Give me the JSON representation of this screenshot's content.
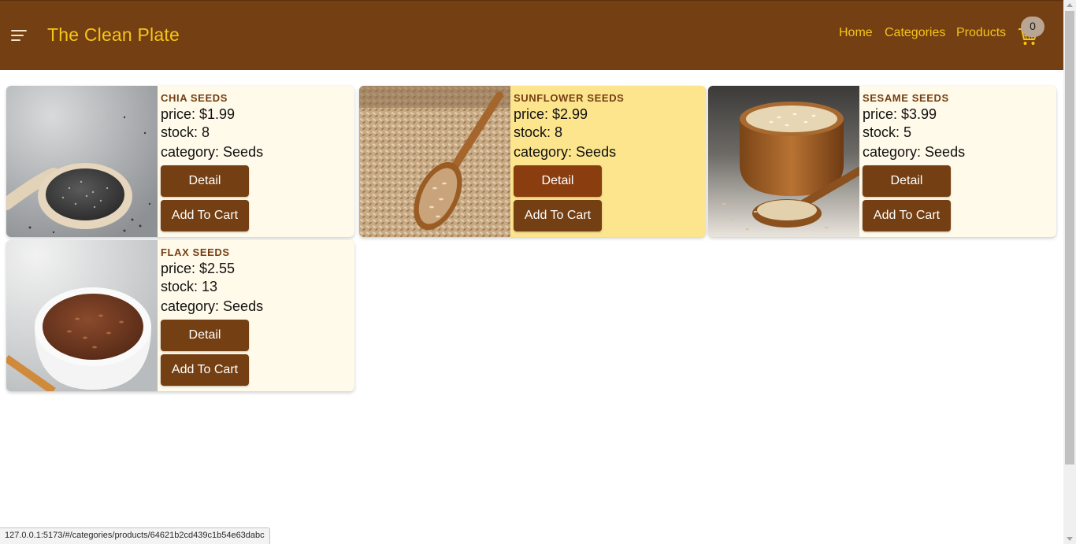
{
  "app": {
    "title": "The Clean Plate",
    "nav": [
      "Home",
      "Categories",
      "Products"
    ],
    "cart_count": "0"
  },
  "products": [
    {
      "name": "Chia Seeds",
      "price": "price: $1.99",
      "stock": "stock: 8",
      "category": "category: Seeds",
      "detail_label": "Detail",
      "add_label": "Add To Cart",
      "image": "chia-seeds-spoon-image"
    },
    {
      "name": "Sunflower Seeds",
      "price": "price: $2.99",
      "stock": "stock: 8",
      "category": "category: Seeds",
      "detail_label": "Detail",
      "add_label": "Add To Cart",
      "image": "sunflower-seeds-spoon-image"
    },
    {
      "name": "Sesame Seeds",
      "price": "price: $3.99",
      "stock": "stock: 5",
      "category": "category: Seeds",
      "detail_label": "Detail",
      "add_label": "Add To Cart",
      "image": "sesame-seeds-bowl-image"
    },
    {
      "name": "Flax Seeds",
      "price": "price: $2.55",
      "stock": "stock: 13",
      "category": "category: Seeds",
      "detail_label": "Detail",
      "add_label": "Add To Cart",
      "image": "flax-seeds-bowl-image"
    }
  ],
  "status_bar": {
    "url": "127.0.0.1:5173/#/categories/products/64621b2cd439c1b54e63dabc"
  },
  "colors": {
    "header_bg": "#743f12",
    "brand_text": "#f5c518",
    "card_bg": "#fffaea",
    "card_hover_bg": "#fde58e",
    "button_bg": "#743f12"
  }
}
